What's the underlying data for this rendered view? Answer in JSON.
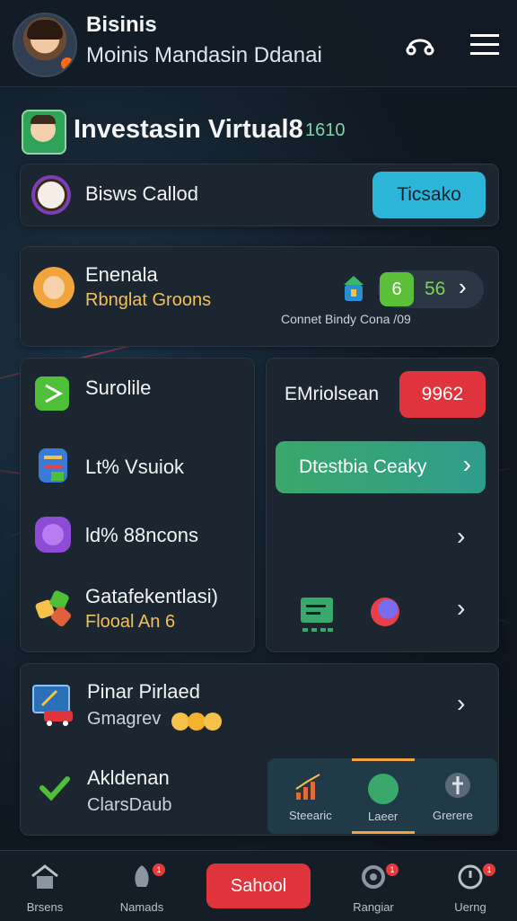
{
  "header": {
    "title": "Bisinis",
    "subtitle": "Moinis Mandasin Ddanai",
    "search_icon": "headphone-icon",
    "menu_icon": "hamburger-icon"
  },
  "section": {
    "title": "Investasin Virtual8",
    "counter": "1610"
  },
  "bisnis_card": {
    "label": "Bisws Callod",
    "button": "Ticsako"
  },
  "profile_card": {
    "name": "Enenala",
    "sub": "Rbnglat Groons",
    "badge_num": "6",
    "score": "56",
    "footer": "Connet Bindy Cona /09"
  },
  "left_panel": {
    "items": [
      {
        "label": "Surolile",
        "sub": ""
      },
      {
        "label": "Lt% Vsuiok",
        "sub": ""
      },
      {
        "label": "ld% 88ncons",
        "sub": ""
      },
      {
        "label": "Gatafekentlasi)",
        "sub": "Flooal An 6"
      }
    ]
  },
  "right_panel": {
    "label": "EMriolsean",
    "value": "9962",
    "action_button": "Dtestbia Ceaky"
  },
  "lower_card": {
    "items": [
      {
        "label": "Pinar Pirlaed",
        "sub": "Gmagrev"
      },
      {
        "label": "Akldenan",
        "sub": "ClarsDaub"
      }
    ]
  },
  "tabs": [
    {
      "label": "Steearic",
      "icon": "chart-icon"
    },
    {
      "label": "Laeer",
      "icon": "leaf-icon"
    },
    {
      "label": "Grerere",
      "icon": "pin-icon"
    }
  ],
  "nav": {
    "items": [
      {
        "label": "Brsens",
        "icon": "home-icon"
      },
      {
        "label": "Namads",
        "icon": "rocket-icon",
        "badge": "1"
      },
      {
        "label": "Sahool",
        "icon": "",
        "primary": true
      },
      {
        "label": "Rangiar",
        "icon": "gear-icon",
        "badge": "1"
      },
      {
        "label": "Uerng",
        "icon": "clock-icon",
        "badge": "1"
      }
    ]
  },
  "colors": {
    "accent_teal": "#2bb6d9",
    "accent_green": "#3aa86a",
    "accent_red": "#e0343c",
    "card_bg": "#1c2630"
  }
}
